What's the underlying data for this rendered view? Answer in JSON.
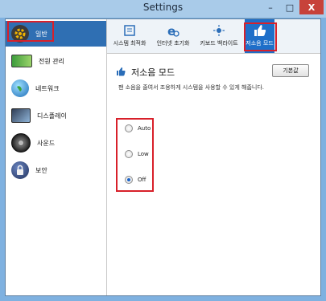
{
  "window": {
    "title": "Settings",
    "controls": {
      "minimize": "–",
      "maximize": "□",
      "close": "X"
    }
  },
  "sidebar": {
    "items": [
      {
        "label": "일반",
        "icon": "gear-icon",
        "selected": true
      },
      {
        "label": "전원 관리",
        "icon": "battery-icon",
        "selected": false
      },
      {
        "label": "네트워크",
        "icon": "globe-icon",
        "selected": false
      },
      {
        "label": "디스플레이",
        "icon": "monitor-icon",
        "selected": false
      },
      {
        "label": "사운드",
        "icon": "speaker-icon",
        "selected": false
      },
      {
        "label": "보안",
        "icon": "lock-icon",
        "selected": false
      }
    ]
  },
  "tabs": [
    {
      "label": "시스템 최적화",
      "icon": "system-optimize-icon",
      "active": false
    },
    {
      "label": "인터넷 초기화",
      "icon": "internet-reset-icon",
      "active": false
    },
    {
      "label": "키보드 백라이트",
      "icon": "keyboard-backlight-icon",
      "active": false
    },
    {
      "label": "저소음 모드",
      "icon": "silent-mode-icon",
      "active": true
    }
  ],
  "content": {
    "section_title": "저소음 모드",
    "default_button": "기본값",
    "description": "팬 소음을 줄여서 조용하게 시스템을 사용할 수 있게 해줍니다.",
    "options": [
      {
        "label": "Auto",
        "checked": false
      },
      {
        "label": "Low",
        "checked": false
      },
      {
        "label": "Off",
        "checked": true
      }
    ]
  },
  "colors": {
    "accent": "#1e6fc9",
    "highlight_box": "#d8202a",
    "close_button": "#c7423a"
  }
}
